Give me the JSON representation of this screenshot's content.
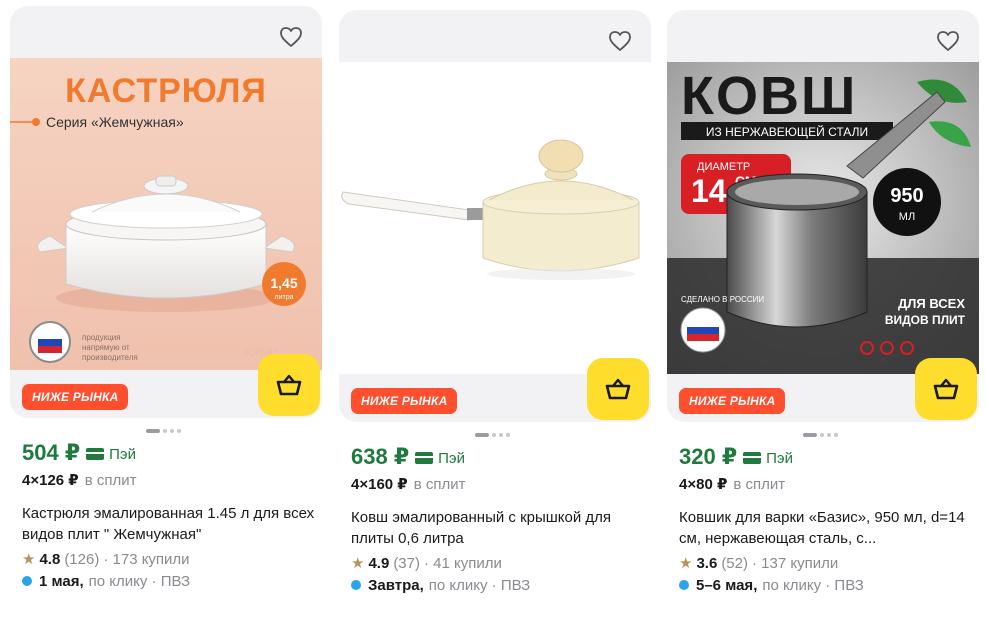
{
  "products": [
    {
      "badge": "НИЖЕ РЫНКА",
      "price": "504 ₽",
      "pay_label": "Пэй",
      "split_amount": "4×126 ₽",
      "split_label": "в сплит",
      "title": "Кастрюля эмалированная 1.45 л для всех видов плит \" Жемчужная\"",
      "rating": "4.8",
      "reviews": "(126)",
      "bought": "· 173 купили",
      "delivery_date": "1 мая,",
      "delivery_method": "по клику · ПВЗ",
      "image": {
        "headline": "КАСТРЮЛЯ",
        "subline": "Серия «Жемчужная»",
        "volume": "1,45",
        "volume_unit": "литра",
        "maker_note": "продукция\nнапрямую от\nпроизводителя",
        "brand": "ЭСКЕЙТ"
      },
      "images_count": 4,
      "active_image": 0
    },
    {
      "badge": "НИЖЕ РЫНКА",
      "price": "638 ₽",
      "pay_label": "Пэй",
      "split_amount": "4×160 ₽",
      "split_label": "в сплит",
      "title": "Ковш эмалированный с крышкой для плиты 0,6 литра",
      "rating": "4.9",
      "reviews": "(37)",
      "bought": "· 41 купили",
      "delivery_date": "Завтра,",
      "delivery_method": "по клику · ПВЗ",
      "images_count": 4,
      "active_image": 0
    },
    {
      "badge": "НИЖЕ РЫНКА",
      "price": "320 ₽",
      "pay_label": "Пэй",
      "split_amount": "4×80 ₽",
      "split_label": "в сплит",
      "title": "Ковшик для варки «Базис», 950 мл, d=14 см, нержавеющая сталь, с...",
      "rating": "3.6",
      "reviews": "(52)",
      "bought": "· 137 купили",
      "delivery_date": "5–6 мая,",
      "delivery_method": "по клику · ПВЗ",
      "image": {
        "headline": "КОВШ",
        "subline": "ИЗ НЕРЖАВЕЮЩЕЙ СТАЛИ",
        "diameter_label": "ДИАМЕТР",
        "diameter_value": "14",
        "diameter_unit": "СМ",
        "volume": "950",
        "volume_unit": "МЛ",
        "made_in": "СДЕЛАНО В РОССИИ",
        "stoves_line1": "ДЛЯ ВСЕХ",
        "stoves_line2": "ВИДОВ ПЛИТ"
      },
      "images_count": 4,
      "active_image": 0
    }
  ],
  "colors": {
    "price_green": "#1f7a3d",
    "badge_red": "#ff4f2e",
    "cart_yellow": "#ffdd2d",
    "delivery_blue": "#27a5e8",
    "star_gold": "#b79558"
  }
}
